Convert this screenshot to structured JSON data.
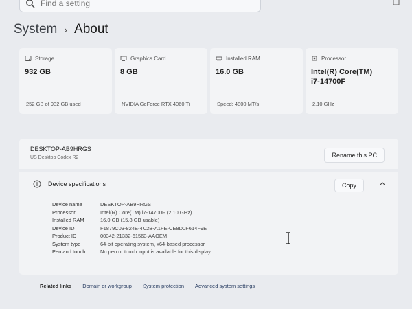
{
  "search": {
    "placeholder": "Find a setting"
  },
  "breadcrumb": {
    "root": "System",
    "separator": "›",
    "current": "About"
  },
  "cards": [
    {
      "title": "Storage",
      "value": "932 GB",
      "sub": "252 GB of 932 GB used",
      "icon": "storage-icon"
    },
    {
      "title": "Graphics Card",
      "value": "8 GB",
      "sub": "NVIDIA GeForce RTX 4060 Ti",
      "icon": "graphics-card-icon"
    },
    {
      "title": "Installed RAM",
      "value": "16.0 GB",
      "sub": "Speed: 4800 MT/s",
      "icon": "ram-icon"
    },
    {
      "title": "Processor",
      "value": "Intel(R) Core(TM) i7-14700F",
      "sub": "2.10 GHz",
      "icon": "processor-icon"
    }
  ],
  "device": {
    "name": "DESKTOP-AB9HRGS",
    "model": "US Desktop Codex R2",
    "rename_label": "Rename this PC"
  },
  "specs": {
    "title": "Device specifications",
    "copy_label": "Copy",
    "rows": [
      {
        "label": "Device name",
        "value": "DESKTOP-AB9HRGS"
      },
      {
        "label": "Processor",
        "value": "Intel(R) Core(TM) i7-14700F (2.10 GHz)"
      },
      {
        "label": "Installed RAM",
        "value": "16.0 GB (15.8 GB usable)"
      },
      {
        "label": "Device ID",
        "value": "F1879C03-824E-4C2B-A1FE-CE8D0F614F9E"
      },
      {
        "label": "Product ID",
        "value": "00342-21332-61563-AAOEM"
      },
      {
        "label": "System type",
        "value": "64-bit operating system, x64-based processor"
      },
      {
        "label": "Pen and touch",
        "value": "No pen or touch input is available for this display"
      }
    ]
  },
  "related": {
    "label": "Related links",
    "links": [
      "Domain or workgroup",
      "System protection",
      "Advanced system settings"
    ]
  },
  "colors": {
    "background": "#e9ebef",
    "card": "#f3f4f6",
    "link": "#2b3f63"
  }
}
